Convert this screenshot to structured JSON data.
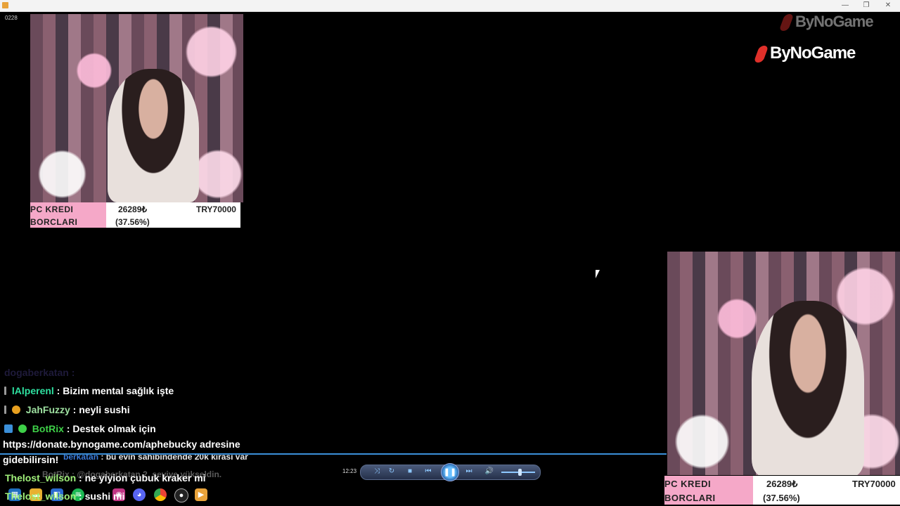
{
  "window": {
    "minimize_glyph": "—",
    "restore_glyph": "❐",
    "close_glyph": "✕"
  },
  "frame_counter": "0228",
  "logos": {
    "top_text": "ByNoGame",
    "main_text": "ByNoGame"
  },
  "debt_overlay": {
    "label_line1": "PC KREDI",
    "label_line2": "BORCLARI",
    "amount": "26289₺",
    "percent": "(37.56%)",
    "target": "TRY70000",
    "progress_percent": 37.56
  },
  "chat": {
    "lines": [
      {
        "user": "dogaberkatan",
        "sep": " : ",
        "message": ""
      },
      {
        "user": "lAlperenl",
        "sep": " : ",
        "message": "Bizim mental sağlık işte",
        "color": "#2ee0a0"
      },
      {
        "user": "JahFuzzy",
        "sep": " : ",
        "message": "neyli sushi",
        "color": "#9ee0a0"
      },
      {
        "user": "BotRix",
        "sep": " : ",
        "message": "Destek olmak için",
        "color": "#3ed048"
      },
      {
        "message": "https://donate.bynogame.com/aphebucky adresine"
      },
      {
        "message": "gidebilirsin!"
      },
      {
        "user": "berkatan",
        "sep": " : ",
        "message": "bu evin sahibindende 20k kirası var",
        "color": "#3a7ad9"
      },
      {
        "user": "BotRix",
        "sep": " : ",
        "message": "@dogaberkatan 2. seviye yükseldin."
      },
      {
        "user": "Thelost_wilson",
        "sep": " : ",
        "message": "ne yiyion çubuk kraker mi",
        "color": "#a0f07a"
      },
      {
        "user": "Thelost_wilson",
        "sep": " : ",
        "message": "sushi mi",
        "color": "#a0f07a"
      }
    ]
  },
  "player": {
    "elapsed": "12:23",
    "play_pause_glyph": "❚❚",
    "volume_level": 0.55
  },
  "taskbar": {
    "icons": [
      "file-explorer-icon",
      "folder-icon",
      "store-icon",
      "spotify-icon",
      "instagram-icon",
      "discord-icon",
      "chrome-icon",
      "obs-icon",
      "media-player-icon"
    ]
  },
  "colors": {
    "overlay_pink": "#f5a8c8",
    "player_accent": "#3b8fd9",
    "logo_red": "#e0302a"
  }
}
